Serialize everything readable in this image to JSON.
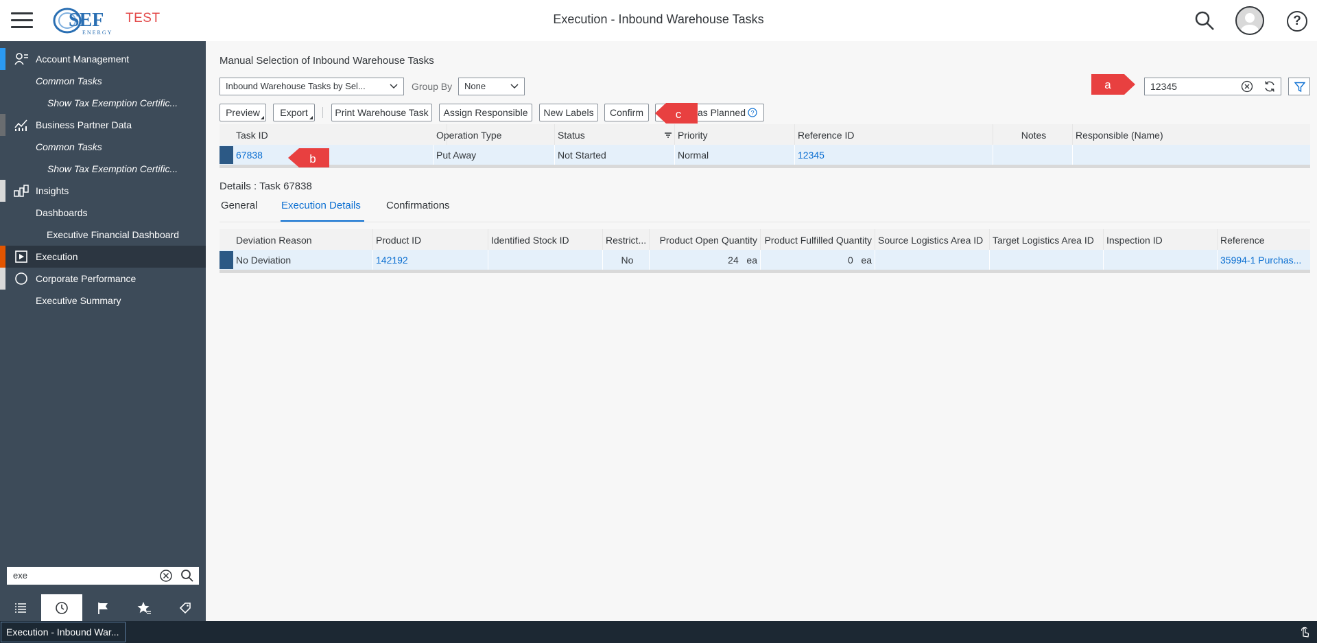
{
  "header": {
    "title": "Execution - Inbound Warehouse Tasks",
    "env_label": "TEST",
    "logo_main": "SEF",
    "logo_sub": "ENERGY"
  },
  "sidebar": {
    "items": [
      {
        "label": "Account Management"
      },
      {
        "label": "Common Tasks"
      },
      {
        "label": "Show Tax Exemption Certific..."
      },
      {
        "label": "Business Partner Data"
      },
      {
        "label": "Common Tasks"
      },
      {
        "label": "Show Tax Exemption Certific..."
      },
      {
        "label": "Insights"
      },
      {
        "label": "Dashboards"
      },
      {
        "label": "Executive Financial Dashboard"
      },
      {
        "label": "Execution"
      },
      {
        "label": "Corporate Performance"
      },
      {
        "label": "Executive Summary"
      }
    ],
    "search_value": "exe"
  },
  "main": {
    "page_title": "Manual Selection of Inbound Warehouse Tasks",
    "view_select": "Inbound Warehouse Tasks by Sel...",
    "group_by_label": "Group By",
    "group_by_value": "None",
    "search_value": "12345",
    "toolbar": {
      "preview": "Preview",
      "export": "Export",
      "print": "Print Warehouse Task",
      "assign": "Assign Responsible",
      "labels": "New Labels",
      "confirm": "Confirm",
      "planned": "as Planned"
    },
    "tasks_table": {
      "headers": [
        "Task ID",
        "Operation Type",
        "Status",
        "Priority",
        "Reference ID",
        "Notes",
        "Responsible (Name)"
      ],
      "rows": [
        {
          "task_id": "67838",
          "operation_type": "Put Away",
          "status": "Not Started",
          "priority": "Normal",
          "reference_id": "12345",
          "notes": "",
          "responsible": ""
        }
      ]
    },
    "details_title": "Details : Task 67838",
    "tabs": [
      "General",
      "Execution Details",
      "Confirmations"
    ],
    "details_table": {
      "headers": [
        "Deviation Reason",
        "Product ID",
        "Identified Stock ID",
        "Restrict...",
        "Product Open Quantity",
        "Product Fulfilled Quantity",
        "Source Logistics Area ID",
        "Target Logistics Area ID",
        "Inspection ID",
        "Reference"
      ],
      "rows": [
        {
          "deviation_reason": "No Deviation",
          "product_id": "142192",
          "stock_id": "",
          "restricted": "No",
          "open_qty": "24",
          "open_unit": "ea",
          "fulfilled_qty": "0",
          "fulfilled_unit": "ea",
          "source_area": "",
          "target_area": "",
          "inspection_id": "",
          "reference": "35994-1 Purchas..."
        }
      ]
    }
  },
  "annotations": {
    "a": "a",
    "b": "b",
    "c": "c"
  },
  "footer": {
    "tab_label": "Execution - Inbound War..."
  },
  "colors": {
    "sidebar_bg": "#3d4b59",
    "accent": "#0a6ed1",
    "env_red": "#e34b4b",
    "callout_red": "#e84040",
    "footer_bg": "#1c2833"
  }
}
